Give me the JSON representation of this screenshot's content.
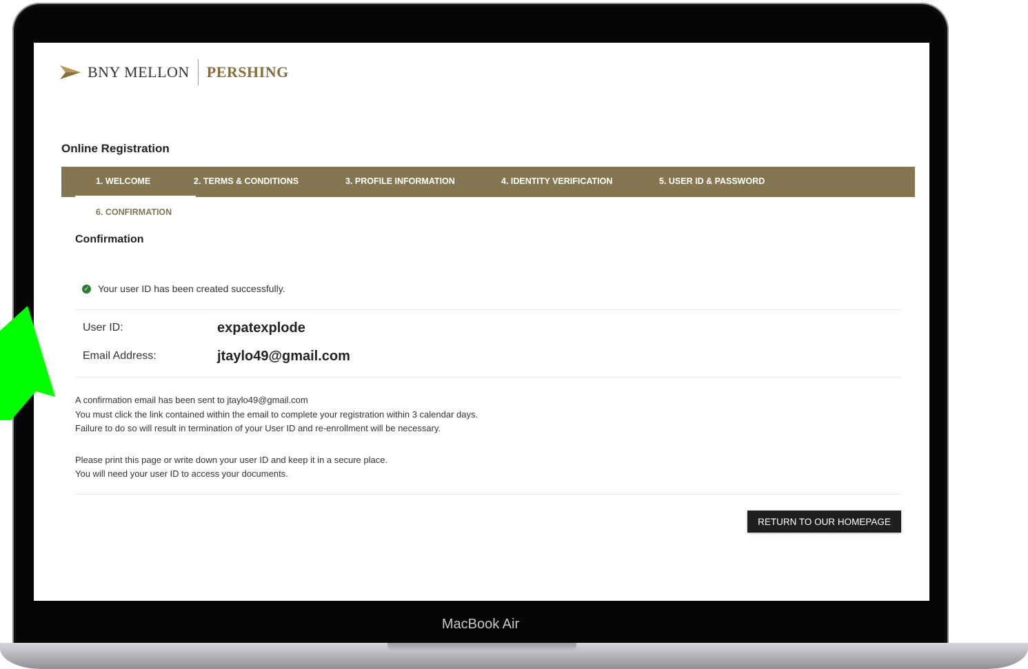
{
  "device": {
    "label": "MacBook Air"
  },
  "brand": {
    "left": "BNY MELLON",
    "right": "PERSHING",
    "color_left": "#333333",
    "color_right": "#8a6d3b"
  },
  "page": {
    "title": "Online Registration"
  },
  "steps": [
    {
      "label": "1. WELCOME"
    },
    {
      "label": "2. TERMS & CONDITIONS"
    },
    {
      "label": "3. PROFILE INFORMATION"
    },
    {
      "label": "4. IDENTITY VERIFICATION"
    },
    {
      "label": "5. USER ID & PASSWORD"
    },
    {
      "label": "6. CONFIRMATION"
    }
  ],
  "steps_bar_color": "#867551",
  "confirmation": {
    "title": "Confirmation",
    "success_message": "Your user ID has been created successfully.",
    "user_id_label": "User ID:",
    "user_id_value": "expatexplode",
    "email_label": "Email Address:",
    "email_value": "jtaylo49@gmail.com",
    "notice_lines": [
      "A confirmation email has been sent to jtaylo49@gmail.com",
      "You must click the link contained within the email to complete your registration within 3 calendar days.",
      "Failure to do so will result in termination of your User ID and re-enrollment will be necessary."
    ],
    "print_lines": [
      "Please print this page or write down your user ID and keep it in a secure place.",
      "You will need your user ID to access your documents."
    ],
    "return_button": "RETURN TO OUR HOMEPAGE"
  },
  "icons": {
    "success": "check-circle-icon",
    "logo": "arrow-mark-icon",
    "overlay": "green-arrow-icon"
  },
  "overlay_color": "#00ff00"
}
